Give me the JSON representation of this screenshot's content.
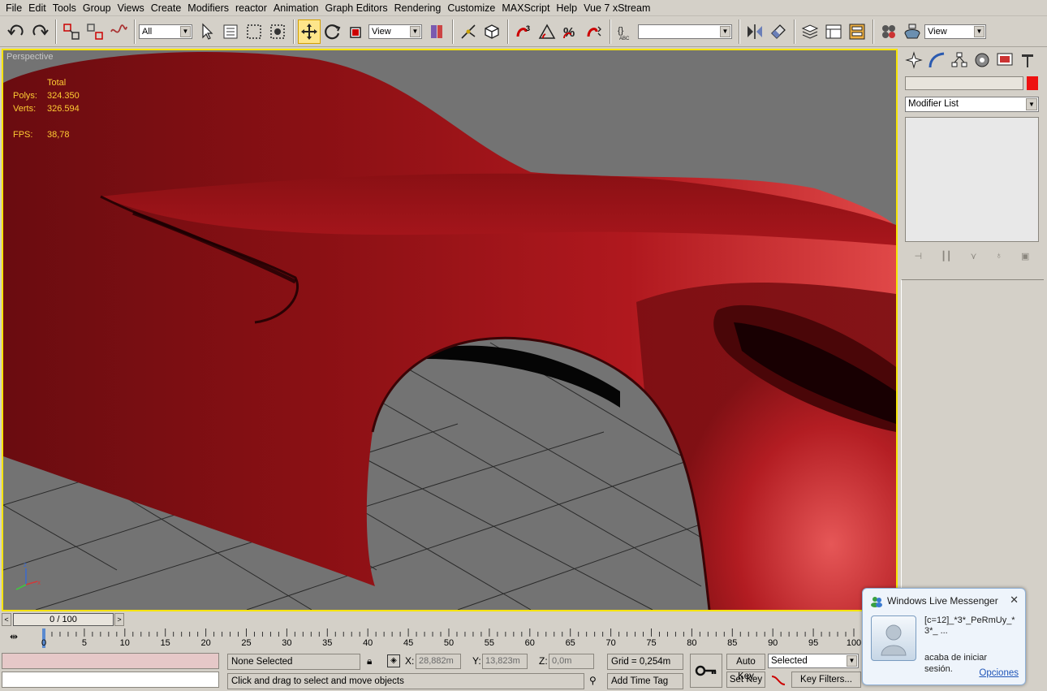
{
  "menu": [
    "File",
    "Edit",
    "Tools",
    "Group",
    "Views",
    "Create",
    "Modifiers",
    "reactor",
    "Animation",
    "Graph Editors",
    "Rendering",
    "Customize",
    "MAXScript",
    "Help",
    "Vue 7 xStream"
  ],
  "toolbar": {
    "selection_filter": "All",
    "ref_coord": "View",
    "named_selection": "",
    "render_view": "View",
    "icons": [
      "undo-icon",
      "redo-icon",
      "select-and-link-icon",
      "unlink-icon",
      "bind-space-warp-icon",
      "select-object-icon",
      "select-by-name-icon",
      "rectangle-selection-icon",
      "window-crossing-icon",
      "select-and-move-icon",
      "select-and-rotate-icon",
      "select-and-scale-icon",
      "use-pivot-center-icon",
      "select-manipulate-icon",
      "keyboard-shortcut-icon",
      "snaps-toggle-icon",
      "angle-snap-icon",
      "percent-snap-icon",
      "spinner-snap-icon",
      "edit-named-selections-icon",
      "mirror-icon",
      "align-icon",
      "layer-manager-icon",
      "curve-editor-icon",
      "schematic-view-icon",
      "material-editor-icon",
      "render-setup-icon"
    ]
  },
  "viewport": {
    "label": "Perspective",
    "stats_header": "Total",
    "polys_label": "Polys:",
    "polys": "324.350",
    "verts_label": "Verts:",
    "verts": "326.594",
    "fps_label": "FPS:",
    "fps": "38,78",
    "bg_color": "#737373",
    "border_color": "#f6e400",
    "model_color": "#a01418"
  },
  "command_panel": {
    "tabs": [
      "create-tab-icon",
      "modify-tab-icon",
      "hierarchy-tab-icon",
      "motion-tab-icon",
      "display-tab-icon",
      "utilities-tab-icon"
    ],
    "object_name": "",
    "object_color": "#ee1111",
    "modifier_list": "Modifier List"
  },
  "timeline": {
    "frame_display": "0 / 100",
    "ticks": [
      "0",
      "5",
      "10",
      "15",
      "20",
      "25",
      "30",
      "35",
      "40",
      "45",
      "50",
      "55",
      "60",
      "65",
      "70",
      "75",
      "80",
      "85",
      "90",
      "95",
      "100"
    ],
    "current_frame": 0
  },
  "status": {
    "selection": "None Selected",
    "prompt": "Click and drag to select and move objects",
    "x_label": "X:",
    "x_value": "28,882m",
    "y_label": "Y:",
    "y_value": "13,823m",
    "z_label": "Z:",
    "z_value": "0,0m",
    "grid": "Grid = 0,254m",
    "add_time_tag": "Add Time Tag",
    "auto_key": "Auto Key",
    "set_key": "Set Key",
    "key_mode": "Selected",
    "key_filters": "Key Filters..."
  },
  "messenger": {
    "title": "Windows Live Messenger",
    "close": "✕",
    "message_line1": "[c=12]_*3*_PeRmUy_*",
    "message_line2": "3*_            ...",
    "message_line3": "acaba de iniciar",
    "message_line4": "sesión.",
    "options": "Opciones"
  }
}
